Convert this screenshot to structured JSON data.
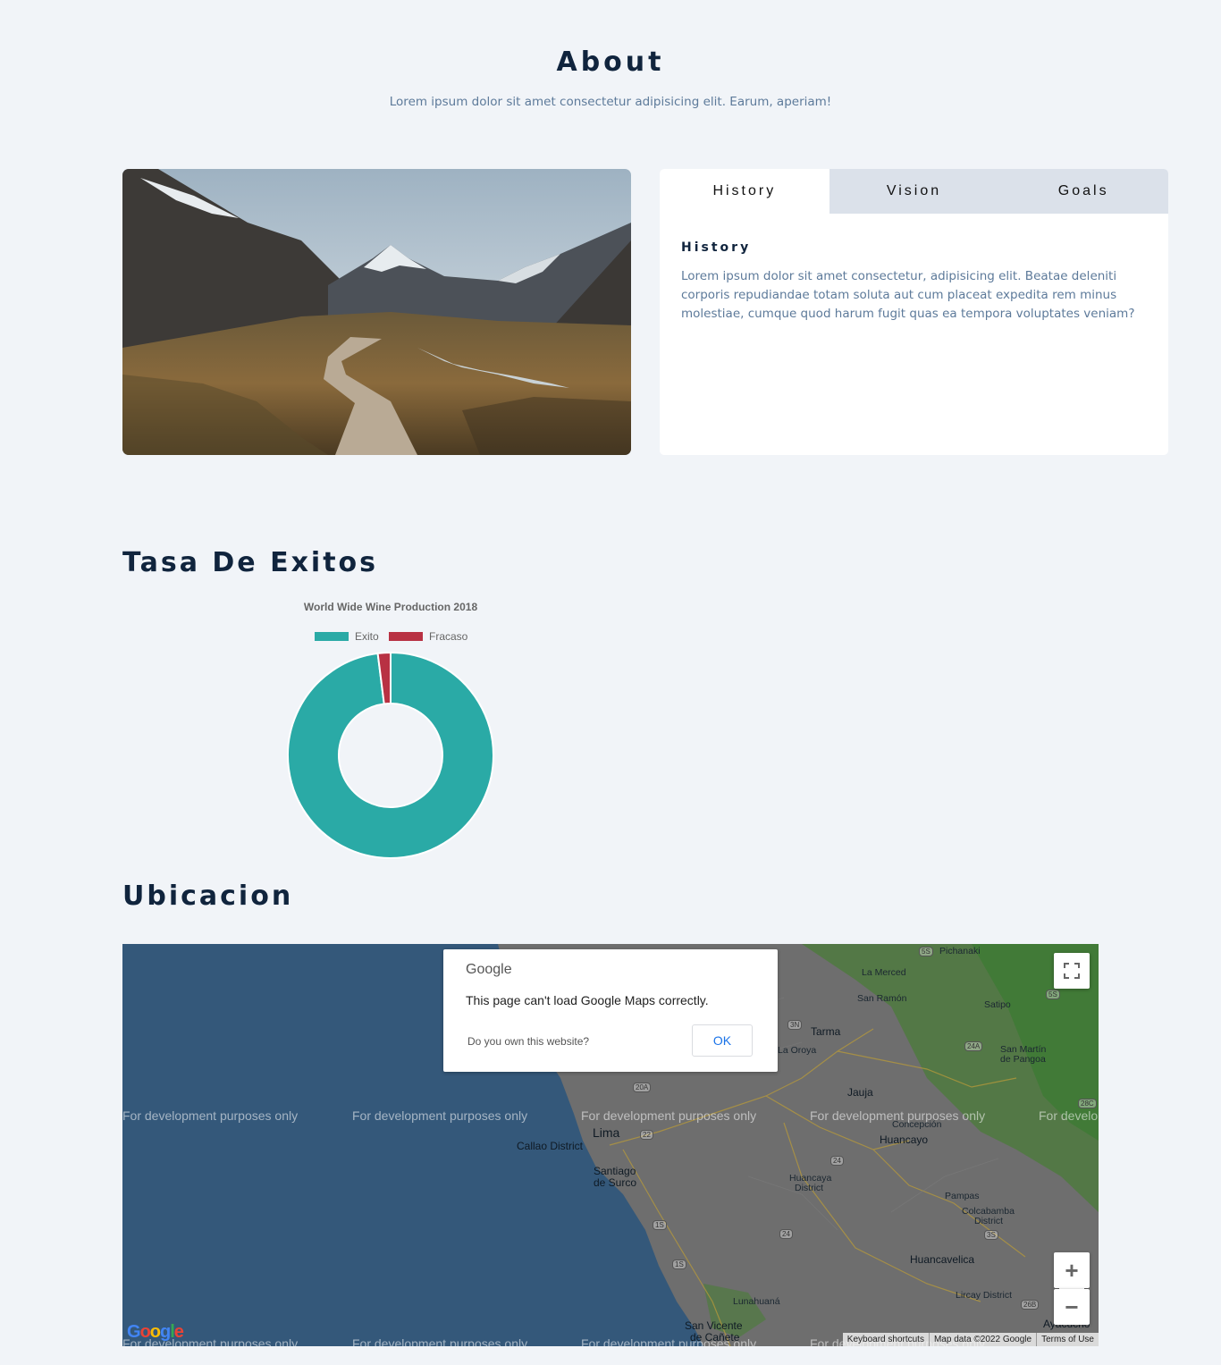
{
  "about": {
    "title": "About",
    "subtitle": "Lorem ipsum dolor sit amet consectetur adipisicing elit. Earum, aperiam!"
  },
  "tabs": {
    "items": [
      {
        "label": "History"
      },
      {
        "label": "Vision"
      },
      {
        "label": "Goals"
      }
    ],
    "active": "History",
    "content_heading": "History",
    "content_text": "Lorem ipsum dolor sit amet consectetur, adipisicing elit. Beatae deleniti corporis repudiandae totam soluta aut cum placeat expedita rem minus molestiae, cumque quod harum fugit quas ea tempora voluptates veniam?"
  },
  "tasa": {
    "title": "Tasa De Exitos"
  },
  "chart_data": {
    "type": "pie",
    "variant": "doughnut",
    "title": "World Wide Wine Production 2018",
    "legend_position": "top",
    "categories": [
      "Exito",
      "Fracaso"
    ],
    "values": [
      98,
      2
    ],
    "colors": [
      "#2aaaa6",
      "#b83143"
    ]
  },
  "ubicacion": {
    "title": "Ubicacion"
  },
  "map": {
    "watermark": "For development purposes only",
    "dialog": {
      "logo": "Google",
      "message": "This page can't load Google Maps correctly.",
      "question": "Do you own this website?",
      "ok_label": "OK"
    },
    "zoom_in_label": "+",
    "zoom_out_label": "−",
    "logo_text": "Google",
    "footer": {
      "shortcuts": "Keyboard shortcuts",
      "map_data": "Map data ©2022 Google",
      "terms": "Terms of Use"
    },
    "places": {
      "lima": "Lima",
      "callao": "Callao District",
      "santiago1": "Santiago",
      "santiago2": "de Surco",
      "huancayo": "Huancayo",
      "concepcion": "Concepción",
      "jauja": "Jauja",
      "tarma": "Tarma",
      "la_oroya": "La Oroya",
      "la_merced": "La Merced",
      "san_ramon": "San Ramón",
      "satipo": "Satipo",
      "pichanaki": "Pichanaki",
      "san_martin1": "San Martín",
      "san_martin2": "de Pangoa",
      "huancaya1": "Huancaya",
      "huancaya2": "District",
      "pampas": "Pampas",
      "colcabamba1": "Colcabamba",
      "colcabamba2": "District",
      "huancavelica": "Huancavelica",
      "lircay": "Lircay District",
      "lunahuana": "Lunahuaná",
      "san_vicente1": "San Vicente",
      "san_vicente2": "de Cañete",
      "ayacucho": "Ayacucho"
    },
    "routes": [
      "5S",
      "3N",
      "24A",
      "20A",
      "22",
      "24",
      "1S",
      "1S",
      "24",
      "3S",
      "26B",
      "28C",
      "5S"
    ]
  },
  "colors": {
    "background": "#f1f4f8",
    "heading": "#10243d",
    "muted_text": "#5d7a9a",
    "tab_bar": "#dbe1ea",
    "exito": "#2aaaa6",
    "fracaso": "#b83143",
    "ocean": "#34587a"
  }
}
